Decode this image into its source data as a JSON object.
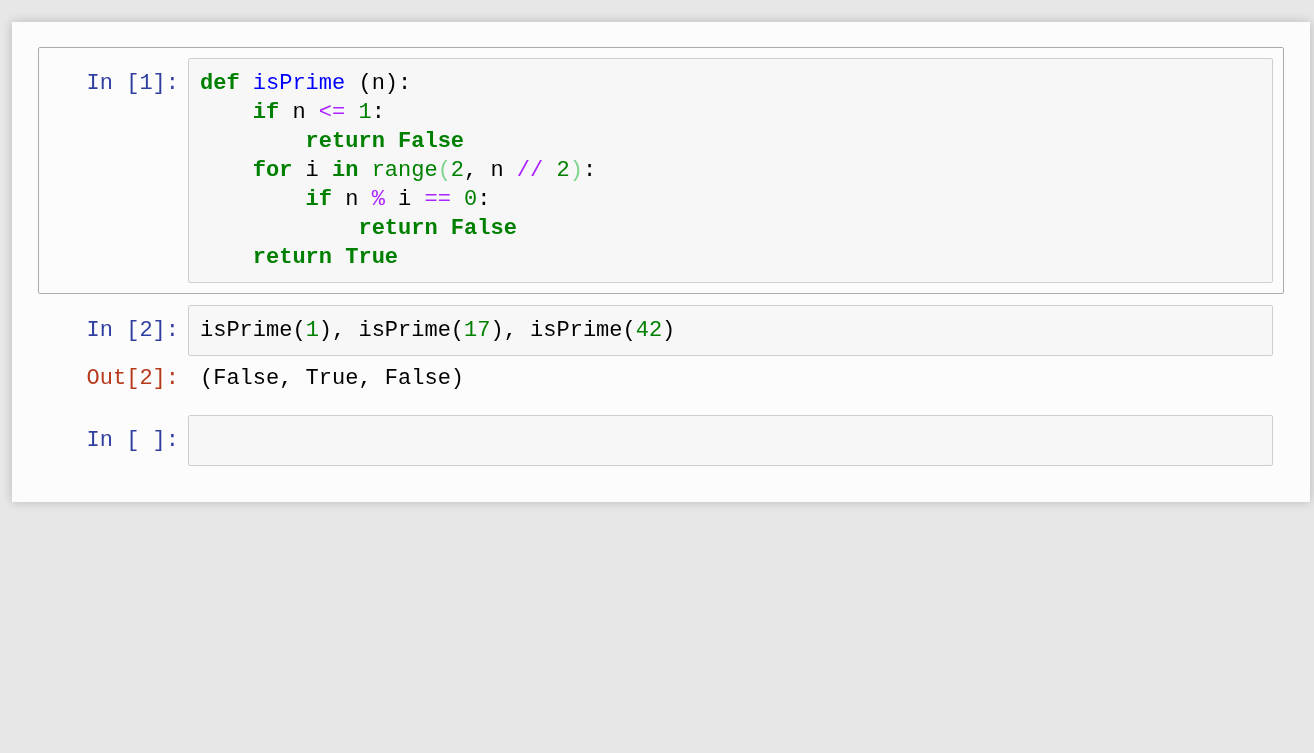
{
  "cells": [
    {
      "prompt": "In [1]:",
      "selected": true,
      "lines": [
        [
          {
            "t": "def",
            "kind": "kw"
          },
          {
            "t": " isPrime",
            "kind": "defname"
          },
          {
            "t": " (n):",
            "kind": "plain"
          }
        ],
        [
          {
            "t": "    if",
            "kind": "kw"
          },
          {
            "t": " n",
            "kind": "plain"
          },
          {
            "t": " <=",
            "kind": "op"
          },
          {
            "t": " 1",
            "kind": "num"
          },
          {
            "t": ":",
            "kind": "plain"
          }
        ],
        [
          {
            "t": "        return",
            "kind": "kw"
          },
          {
            "t": " False",
            "kind": "kw"
          }
        ],
        [
          {
            "t": "    for",
            "kind": "kw"
          },
          {
            "t": " i",
            "kind": "plain"
          },
          {
            "t": " in",
            "kind": "kw"
          },
          {
            "t": " range",
            "kind": "builtin"
          },
          {
            "t": "(",
            "kind": "bracket"
          },
          {
            "t": "2",
            "kind": "num"
          },
          {
            "t": ", n",
            "kind": "plain"
          },
          {
            "t": " //",
            "kind": "op"
          },
          {
            "t": " 2",
            "kind": "num"
          },
          {
            "t": ")",
            "kind": "bracket"
          },
          {
            "t": ":",
            "kind": "plain"
          }
        ],
        [
          {
            "t": "        if",
            "kind": "kw"
          },
          {
            "t": " n",
            "kind": "plain"
          },
          {
            "t": " %",
            "kind": "op"
          },
          {
            "t": " i",
            "kind": "plain"
          },
          {
            "t": " ==",
            "kind": "op"
          },
          {
            "t": " 0",
            "kind": "num"
          },
          {
            "t": ":",
            "kind": "plain"
          }
        ],
        [
          {
            "t": "            return",
            "kind": "kw"
          },
          {
            "t": " False",
            "kind": "kw"
          }
        ],
        [
          {
            "t": "    return",
            "kind": "kw"
          },
          {
            "t": " True",
            "kind": "kw"
          }
        ]
      ]
    },
    {
      "prompt": "In [2]:",
      "selected": false,
      "lines": [
        [
          {
            "t": "isPrime(",
            "kind": "plain"
          },
          {
            "t": "1",
            "kind": "num"
          },
          {
            "t": "), isPrime(",
            "kind": "plain"
          },
          {
            "t": "17",
            "kind": "num"
          },
          {
            "t": "), isPrime(",
            "kind": "plain"
          },
          {
            "t": "42",
            "kind": "num"
          },
          {
            "t": ")",
            "kind": "plain"
          }
        ]
      ],
      "output": {
        "prompt": "Out[2]:",
        "text": "(False, True, False)"
      }
    },
    {
      "prompt": "In [ ]:",
      "selected": false
    }
  ]
}
